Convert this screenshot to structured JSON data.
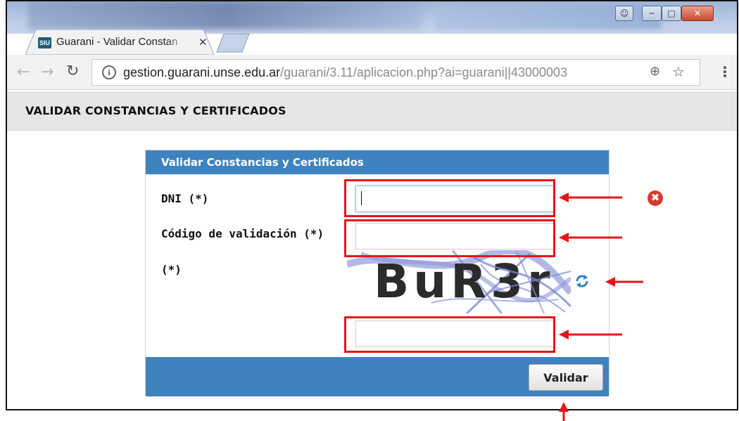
{
  "browser": {
    "tab_favicon": "SIU",
    "tab_title": "Guarani - Validar Constan",
    "tab_close": "✕",
    "window_controls": [
      "user-icon",
      "minimize-icon",
      "maximize-icon",
      "close-icon"
    ],
    "url_host": "gestion.guarani.unse.edu.ar",
    "url_path": "/guarani/3.11/aplicacion.php?ai=guarani||43000003",
    "icons": [
      "back-icon",
      "forward-icon",
      "reload-icon",
      "info-icon",
      "zoom-icon",
      "star-icon",
      "menu-icon"
    ]
  },
  "page": {
    "title": "VALIDAR CONSTANCIAS Y CERTIFICADOS"
  },
  "form": {
    "header": "Validar Constancias y Certificados",
    "dni_label": "DNI (*)",
    "dni_value": "",
    "codigo_label": "Código de validación (*)",
    "codigo_value": "",
    "captcha_label": "(*)",
    "captcha_text": "BuR3r",
    "captcha_value": "",
    "submit_label": "Validar",
    "error_icon": "✖"
  },
  "annotations": {
    "color": "#e8141b",
    "highlighted": [
      "dni-field",
      "codigo-field",
      "captcha-field"
    ],
    "arrows_point_to": [
      "dni-field",
      "codigo-field",
      "refresh-icon",
      "captcha-field",
      "validar-button"
    ]
  },
  "colors": {
    "panel_blue": "#3e83bf",
    "error_red": "#d83a2c",
    "page_header_bg": "#e6e6e6"
  }
}
